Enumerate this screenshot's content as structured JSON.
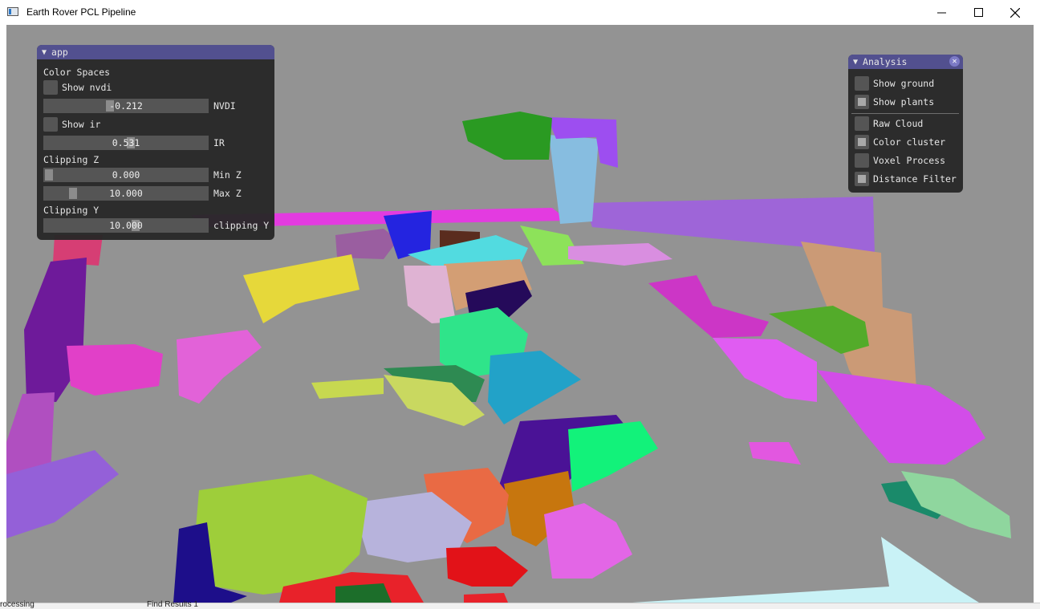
{
  "window": {
    "title": "Earth Rover PCL Pipeline",
    "minimize_icon": "minimize-icon",
    "maximize_icon": "maximize-icon",
    "close_icon": "close-icon"
  },
  "app_panel": {
    "title": "app",
    "color_spaces_header": "Color Spaces",
    "show_nvdi": {
      "label": "Show nvdi",
      "checked": false
    },
    "nvdi_slider": {
      "value": "-0.212",
      "label": "NVDI"
    },
    "show_ir": {
      "label": "Show ir",
      "checked": false
    },
    "ir_slider": {
      "value": "0.531",
      "label": "IR"
    },
    "clipping_z_header": "Clipping Z",
    "min_z_slider": {
      "value": "0.000",
      "label": "Min Z"
    },
    "max_z_slider": {
      "value": "10.000",
      "label": "Max Z"
    },
    "clipping_y_header": "Clipping Y",
    "clipping_y_slider": {
      "value": "10.000",
      "label": "clipping Y"
    }
  },
  "analysis_panel": {
    "title": "Analysis",
    "show_ground": {
      "label": "Show ground",
      "checked": false
    },
    "show_plants": {
      "label": "Show plants",
      "checked": true
    },
    "raw_cloud": {
      "label": "Raw Cloud",
      "checked": false
    },
    "color_cluster": {
      "label": "Color cluster",
      "checked": true
    },
    "voxel_process": {
      "label": "Voxel Process",
      "checked": false
    },
    "distance_filter": {
      "label": "Distance Filter",
      "checked": true
    }
  },
  "background": {
    "find_results_tab": "Find Results 1",
    "left_edge_text": "rocessing"
  },
  "colors": {
    "viewport_bg": "#939393",
    "imgui_title": "#52508f",
    "imgui_body": "#282828"
  }
}
